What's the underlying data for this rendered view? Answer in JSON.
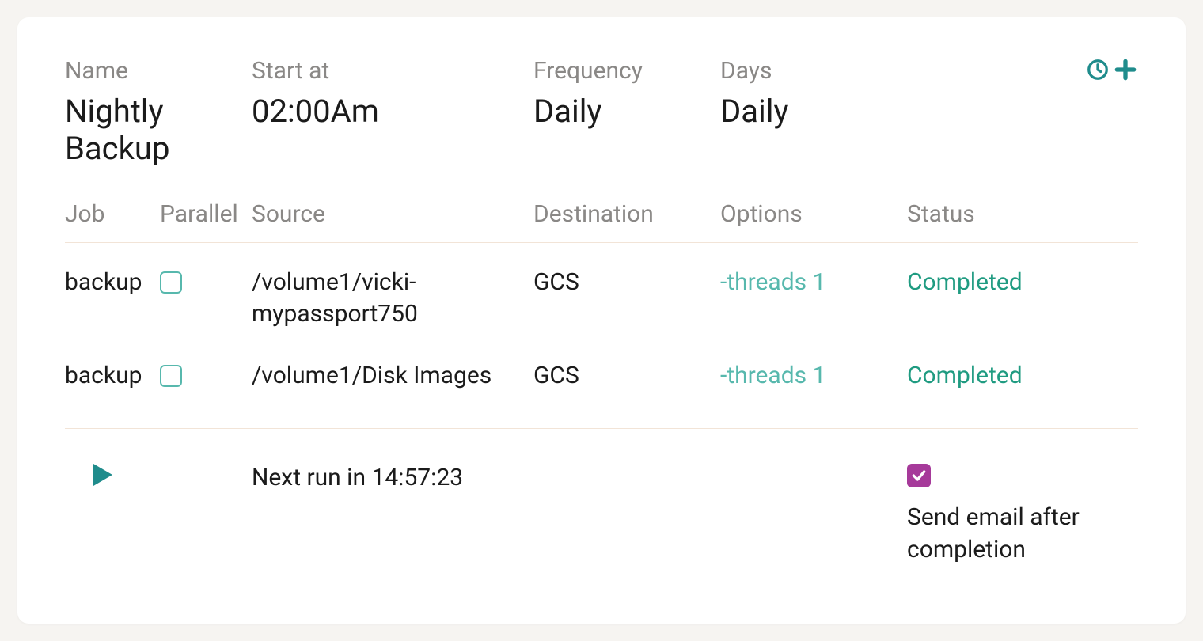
{
  "header": {
    "name_label": "Name",
    "name_value": "Nightly Backup",
    "start_label": "Start at",
    "start_value": "02:00Am",
    "freq_label": "Frequency",
    "freq_value": "Daily",
    "days_label": "Days",
    "days_value": "Daily"
  },
  "columns": {
    "job": "Job",
    "parallel": "Parallel",
    "source": "Source",
    "destination": "Destination",
    "options": "Options",
    "status": "Status"
  },
  "rows": [
    {
      "job": "backup",
      "parallel_checked": false,
      "source": "/volume1/vicki-mypassport750",
      "destination": "GCS",
      "options": "-threads 1",
      "status": "Completed"
    },
    {
      "job": "backup",
      "parallel_checked": false,
      "source": "/volume1/Disk Images",
      "destination": "GCS",
      "options": "-threads 1",
      "status": "Completed"
    }
  ],
  "footer": {
    "next_run": "Next run in 14:57:23",
    "email_checked": true,
    "email_label": "Send email after completion"
  }
}
